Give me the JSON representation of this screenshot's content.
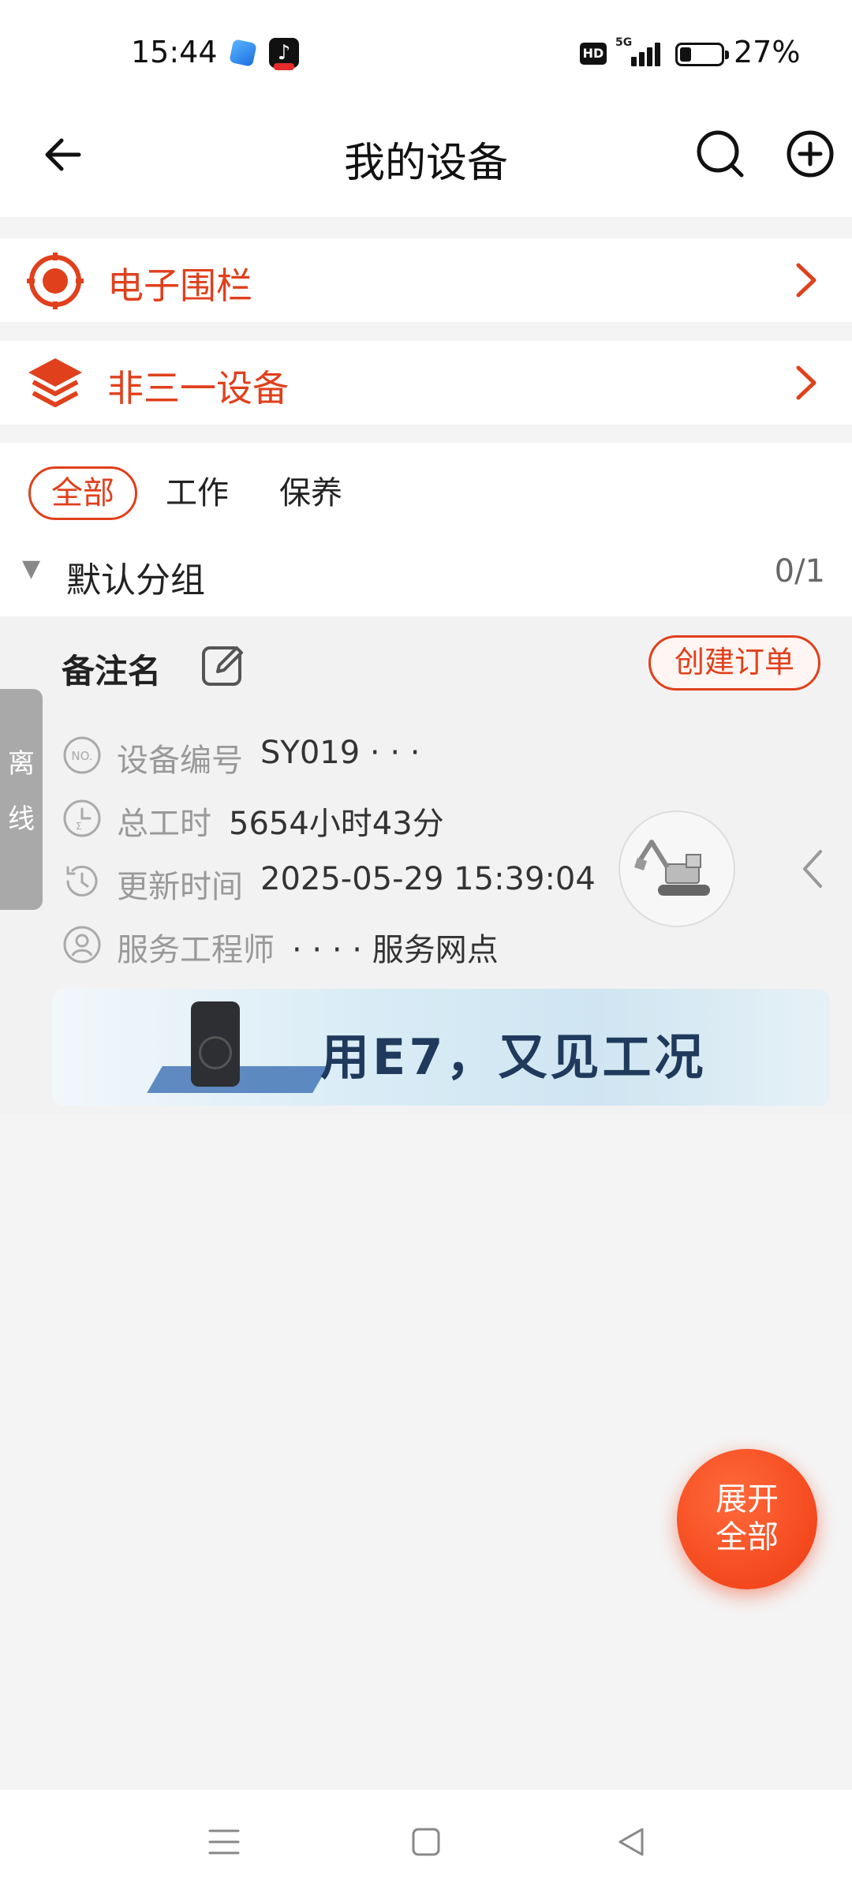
{
  "status_bar": {
    "time": "15:44",
    "hd": "HD",
    "network": "5G",
    "battery_percent": "27%",
    "battery_level": 0.27
  },
  "header": {
    "title": "我的设备"
  },
  "menu": [
    {
      "label": "电子围栏",
      "icon": "geofence-target-icon"
    },
    {
      "label": "非三一设备",
      "icon": "layers-icon"
    }
  ],
  "tabs": [
    {
      "label": "全部",
      "active": true
    },
    {
      "label": "工作",
      "active": false
    },
    {
      "label": "保养",
      "active": false
    }
  ],
  "group": {
    "name": "默认分组",
    "count": "0/1"
  },
  "device": {
    "remark_name": "备注名",
    "status": "离线",
    "create_order_label": "创建订单",
    "fields": [
      {
        "key": "设备编号",
        "value": "SY019 · · ·",
        "icon": "number-badge-icon"
      },
      {
        "key": "总工时",
        "value": "5654小时43分",
        "icon": "work-hours-icon"
      },
      {
        "key": "更新时间",
        "value": "2025-05-29 15:39:04",
        "icon": "clock-icon"
      },
      {
        "key": "服务工程师",
        "value": "· · · ·  服务网点",
        "icon": "user-icon"
      }
    ],
    "avatar": "excavator-icon"
  },
  "banner": {
    "text": "用E7，又见工况"
  },
  "fab": {
    "line1": "展开",
    "line2": "全部"
  },
  "colors": {
    "accent": "#e0401c",
    "fab": "#ef3a12",
    "offline": "#a9a9a9"
  }
}
